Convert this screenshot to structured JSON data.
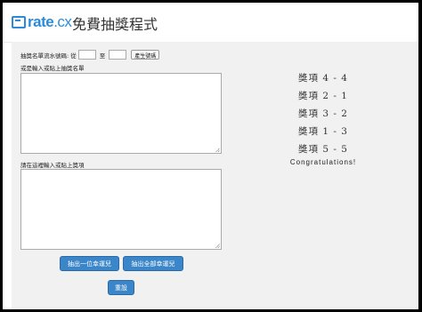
{
  "header": {
    "logo_text_main": "rate",
    "logo_text_suffix": ".cx",
    "title": "免費抽獎程式"
  },
  "form": {
    "range_label": "抽獎名單流水號碼: 從",
    "range_from_value": "",
    "range_to_label": "至",
    "range_to_value": "",
    "generate_button": "產生號碼",
    "names_label": "或是輸入或貼上抽獎名單",
    "names_value": "",
    "prizes_label": "請在這裡輸入或貼上獎項",
    "prizes_value": "",
    "draw_one_button": "抽出一位幸運兒",
    "draw_all_button": "抽出全部幸運兒",
    "reset_button": "重設"
  },
  "results": {
    "prizes": [
      "獎項 4 - 4",
      "獎項 2 - 1",
      "獎項 3 - 2",
      "獎項 1 - 3",
      "獎項 5 - 5"
    ],
    "congrats": "Congratulations!"
  },
  "colors": {
    "brand": "#2b8bd8",
    "button": "#3a86c8",
    "panel_bg": "#f1f1f1"
  }
}
